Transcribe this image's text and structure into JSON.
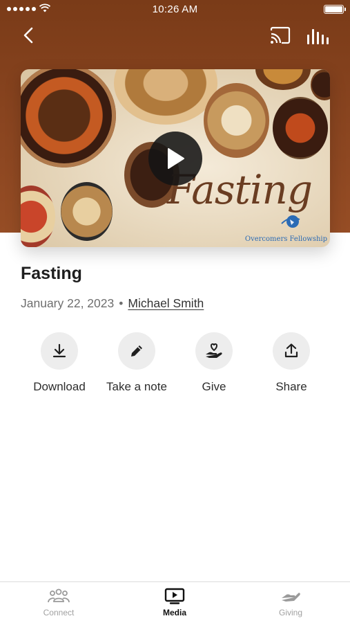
{
  "status_bar": {
    "time": "10:26 AM"
  },
  "media": {
    "hero_title": "Fasting",
    "hero_org": "Overcomers Fellowship",
    "title": "Fasting",
    "date": "January 22, 2023",
    "separator": "•",
    "author": "Michael Smith"
  },
  "actions": [
    {
      "label": "Download",
      "icon": "download-icon"
    },
    {
      "label": "Take a note",
      "icon": "pencil-icon"
    },
    {
      "label": "Give",
      "icon": "hand-heart-icon"
    },
    {
      "label": "Share",
      "icon": "share-icon"
    }
  ],
  "tabs": [
    {
      "label": "Connect",
      "icon": "people-icon",
      "active": false
    },
    {
      "label": "Media",
      "icon": "media-player-icon",
      "active": true
    },
    {
      "label": "Giving",
      "icon": "giving-hand-icon",
      "active": false
    }
  ],
  "colors": {
    "header_bg": "#8a4520",
    "action_circle": "#ededed",
    "tab_active": "#111111",
    "tab_inactive": "#a0a0a0"
  }
}
